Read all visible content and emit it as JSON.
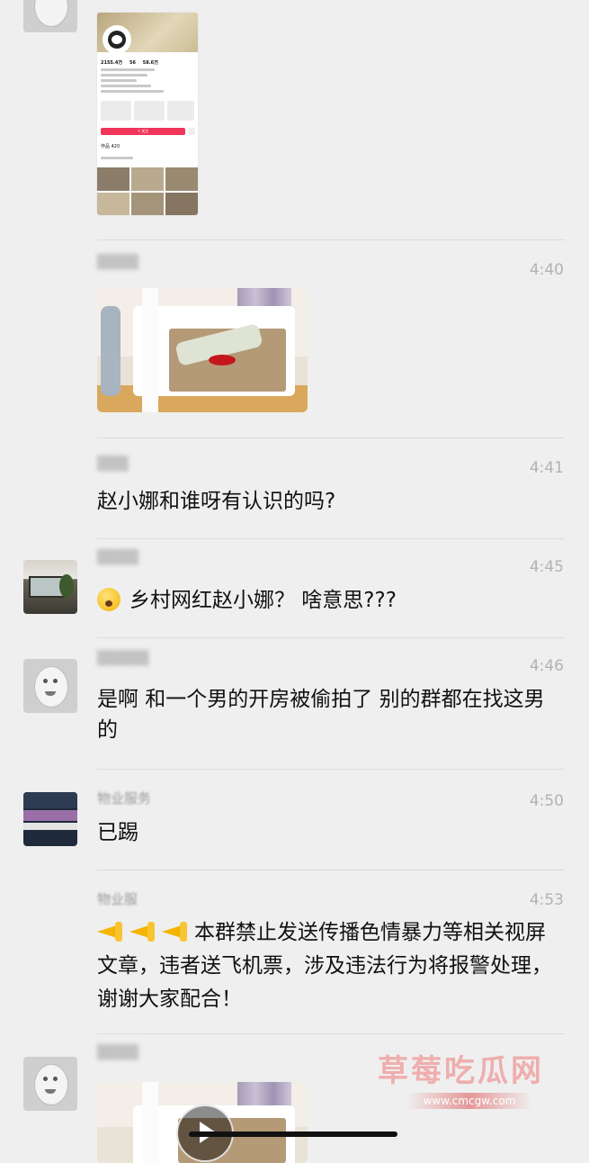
{
  "profile_card": {
    "stats": [
      "2155.4万",
      "56",
      "58.6万"
    ],
    "follow_label": "+ 关注",
    "works_label": "作品 420"
  },
  "messages": [
    {
      "time": "4:40"
    },
    {
      "time": "4:41",
      "text": "赵小娜和谁呀有认识的吗?"
    },
    {
      "time": "4:45",
      "text": "乡村网红赵小娜？ 啥意思???"
    },
    {
      "time": "4:46",
      "text": "是啊 和一个男的开房被偷拍了 别的群都在找这男的"
    },
    {
      "time": "4:50",
      "sender": "物业服务",
      "text": "已踢"
    },
    {
      "time": "4:53",
      "sender": "物业服",
      "text": "本群禁止发送传播色情暴力等相关视屏文章，违者送飞机票，涉及违法行为将报警处理，谢谢大家配合！"
    }
  ],
  "watermark": {
    "title": "草莓吃瓜网",
    "url": "www.cmcgw.com"
  },
  "colors": {
    "background": "#efefef",
    "watermark": "#f0a3a3",
    "follow_button": "#f2355b"
  }
}
